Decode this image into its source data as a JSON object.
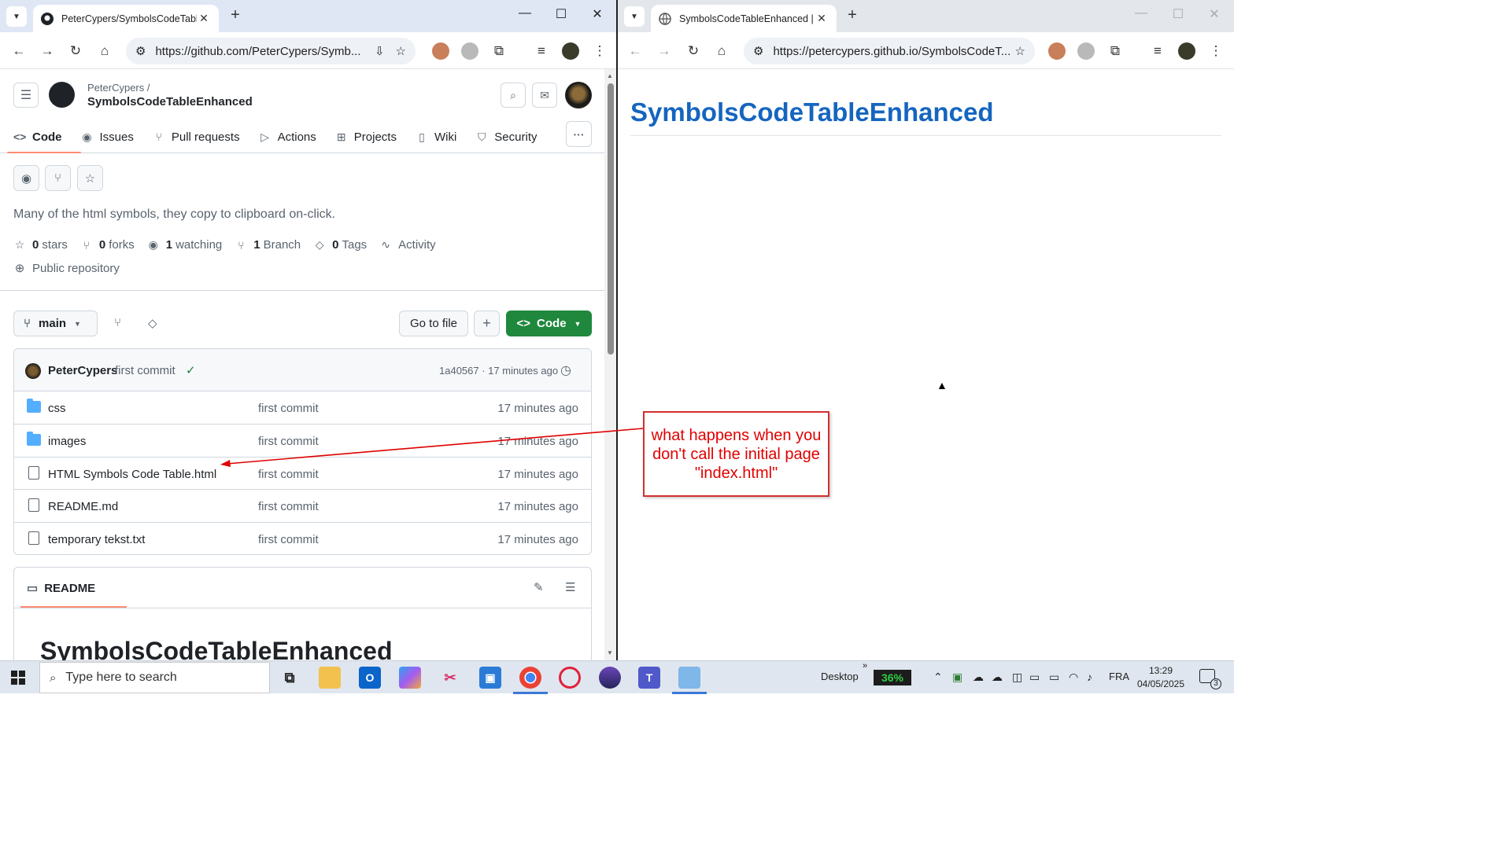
{
  "left_browser": {
    "tab_title": "PeterCypers/SymbolsCodeTable",
    "url": "https://github.com/PeterCypers/Symb...",
    "close_glyph": "✕",
    "new_tab_glyph": "+"
  },
  "right_browser": {
    "tab_title": "SymbolsCodeTableEnhanced | M",
    "url": "https://petercypers.github.io/SymbolsCodeT...",
    "close_glyph": "✕",
    "new_tab_glyph": "+"
  },
  "github": {
    "owner": "PeterCypers /",
    "repo_name": "SymbolsCodeTableEnhanced",
    "nav": [
      {
        "label": "Code",
        "icon": "code-icon"
      },
      {
        "label": "Issues",
        "icon": "issues-icon"
      },
      {
        "label": "Pull requests",
        "icon": "pull-request-icon"
      },
      {
        "label": "Actions",
        "icon": "actions-icon"
      },
      {
        "label": "Projects",
        "icon": "projects-icon"
      },
      {
        "label": "Wiki",
        "icon": "wiki-icon"
      },
      {
        "label": "Security",
        "icon": "shield-icon"
      }
    ],
    "description": "Many of the html symbols, they copy to clipboard on-click.",
    "stats": [
      {
        "value": "0",
        "label": "stars",
        "icon": "star-icon"
      },
      {
        "value": "0",
        "label": "forks",
        "icon": "fork-icon"
      },
      {
        "value": "1",
        "label": "watching",
        "icon": "eye-icon"
      },
      {
        "value": "1",
        "label": "Branch",
        "icon": "branch-icon"
      },
      {
        "value": "0",
        "label": "Tags",
        "icon": "tag-icon"
      },
      {
        "value": "",
        "label": "Activity",
        "icon": "activity-icon"
      }
    ],
    "public_repo": "Public repository",
    "branch": "main",
    "go_to_file": "Go to file",
    "code_button": "Code",
    "commit": {
      "user": "PeterCypers",
      "message": "first commit",
      "meta": "1a40567 · 17 minutes ago"
    },
    "files": [
      {
        "name": "css",
        "type": "folder",
        "commit": "first commit",
        "time": "17 minutes ago"
      },
      {
        "name": "images",
        "type": "folder",
        "commit": "first commit",
        "time": "17 minutes ago"
      },
      {
        "name": "HTML Symbols Code Table.html",
        "type": "file",
        "commit": "first commit",
        "time": "17 minutes ago"
      },
      {
        "name": "README.md",
        "type": "file",
        "commit": "first commit",
        "time": "17 minutes ago"
      },
      {
        "name": "temporary tekst.txt",
        "type": "file",
        "commit": "first commit",
        "time": "17 minutes ago"
      }
    ],
    "readme_tab": "README",
    "readme_heading": "SymbolsCodeTableEnhanced"
  },
  "pages_site": {
    "heading": "SymbolsCodeTableEnhanced"
  },
  "callout": {
    "text": "what happens when you don't call the initial page \"index.html\"",
    "color": "#e00000"
  },
  "taskbar": {
    "search_placeholder": "Type here to search",
    "desktop_label": "Desktop",
    "battery": "36%",
    "language": "FRA",
    "time": "13:29",
    "date": "04/05/2025",
    "notification_count": "3"
  },
  "colors": {
    "github_green": "#1f883d",
    "pages_heading": "#1565c0",
    "nav_underline": "#fd8c73"
  }
}
